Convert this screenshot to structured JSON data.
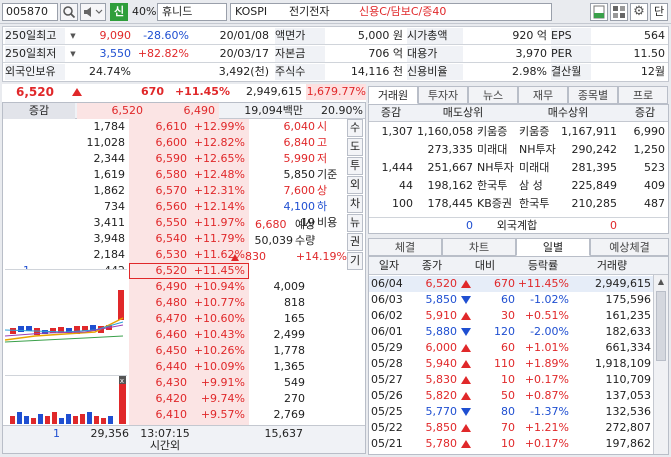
{
  "toolbar": {
    "code": "005870",
    "market_badge": "신",
    "margin": "40%",
    "name": "휴니드",
    "market": "KOSPI",
    "sector": "전기전자",
    "credit": "신용C/담보C/증40",
    "help_label": "단"
  },
  "info": {
    "rows": [
      {
        "label": "250일최고",
        "val": "9,090",
        "pct": "-28.60%",
        "date": "20/01/08",
        "l2": "액면가",
        "v2": "5,000 원",
        "l3": "시가총액",
        "v3": "920 억",
        "l4": "EPS",
        "v4": "564"
      },
      {
        "label": "250일최저",
        "val": "3,550",
        "pct": "+82.82%",
        "date": "20/03/17",
        "l2": "자본금",
        "v2": "706 억",
        "l3": "대용가",
        "v3": "3,970",
        "l4": "PER",
        "v4": "11.50"
      },
      {
        "label": "외국인보유",
        "val": "24.74%",
        "pct": "",
        "date": "3,492(천)",
        "l2": "주식수",
        "v2": "14,116 천",
        "l3": "신용비율",
        "v3": "2.98%",
        "l4": "결산월",
        "v4": "12월"
      }
    ]
  },
  "price_line": {
    "price": "6,520",
    "change": "670",
    "pct": "+11.45%",
    "volume": "2,949,615",
    "vol_pct": "1,679.77%"
  },
  "ob_header": {
    "label": "증감",
    "ask_top": "6,520",
    "bid_top": "6,490",
    "amount": "19,094백만",
    "rate": "20.90%"
  },
  "asks": [
    {
      "qty": "1,784",
      "price": "6,610",
      "pct": "+12.99%"
    },
    {
      "qty": "11,028",
      "price": "6,600",
      "pct": "+12.82%"
    },
    {
      "qty": "2,344",
      "price": "6,590",
      "pct": "+12.65%"
    },
    {
      "qty": "1,619",
      "price": "6,580",
      "pct": "+12.48%"
    },
    {
      "qty": "1,862",
      "price": "6,570",
      "pct": "+12.31%"
    },
    {
      "qty": "734",
      "price": "6,560",
      "pct": "+12.14%"
    },
    {
      "qty": "3,411",
      "price": "6,550",
      "pct": "+11.97%"
    },
    {
      "qty": "3,948",
      "price": "6,540",
      "pct": "+11.79%"
    },
    {
      "qty": "2,184",
      "price": "6,530",
      "pct": "+11.62%"
    },
    {
      "qty": "442",
      "price": "6,520",
      "pct": "+11.45%",
      "chg": "1"
    }
  ],
  "bids": [
    {
      "qty": "4,009",
      "price": "6,490",
      "pct": "+10.94%"
    },
    {
      "qty": "818",
      "price": "6,480",
      "pct": "+10.77%"
    },
    {
      "qty": "165",
      "price": "6,470",
      "pct": "+10.60%"
    },
    {
      "qty": "2,499",
      "price": "6,460",
      "pct": "+10.43%"
    },
    {
      "qty": "1,778",
      "price": "6,450",
      "pct": "+10.26%"
    },
    {
      "qty": "1,365",
      "price": "6,440",
      "pct": "+10.09%"
    },
    {
      "qty": "549",
      "price": "6,430",
      "pct": "+9.91%"
    },
    {
      "qty": "270",
      "price": "6,420",
      "pct": "+9.74%"
    },
    {
      "qty": "2,769",
      "price": "6,410",
      "pct": "+9.57%"
    },
    {
      "qty": "1,415",
      "price": "6,400",
      "pct": "+9.40%"
    }
  ],
  "ohlc": [
    {
      "price": "6,040",
      "label": "시",
      "color": "r"
    },
    {
      "price": "6,840",
      "label": "고",
      "color": "r"
    },
    {
      "price": "5,990",
      "label": "저",
      "color": "r"
    },
    {
      "price": "5,850",
      "label": "기준",
      "color": "k"
    },
    {
      "price": "7,600",
      "label": "상",
      "color": "r"
    },
    {
      "price": "4,100",
      "label": "하",
      "color": "b"
    },
    {
      "price": "19",
      "label": "비용",
      "color": "k"
    }
  ],
  "expect": {
    "price_label": "예상",
    "price": "6,680",
    "qty_label": "수량",
    "qty": "50,039",
    "chg": "830",
    "pct": "+14.19%"
  },
  "side_buttons": [
    "수",
    "도",
    "투",
    "외",
    "차",
    "뉴",
    "권",
    "기"
  ],
  "ob_footer": {
    "left": "1",
    "total_ask": "29,356",
    "time": "13:07:15",
    "total_bid": "15,637",
    "time_label": "시간외"
  },
  "broker_tabs": [
    "거래원",
    "투자자",
    "뉴스",
    "재무",
    "종목별",
    "프로"
  ],
  "broker_header": {
    "c1": "증감",
    "c2": "매도상위",
    "c3": "매수상위",
    "c4": "증감"
  },
  "brokers": [
    {
      "schg": "1,307",
      "sqty": "1,160,058",
      "sname": "키움증",
      "bname": "키움증",
      "bqty": "1,167,911",
      "bchg": "6,990"
    },
    {
      "schg": "",
      "sqty": "273,335",
      "sname": "미래대",
      "bname": "NH투자",
      "bqty": "290,242",
      "bchg": "1,250"
    },
    {
      "schg": "1,444",
      "sqty": "251,667",
      "sname": "NH투자",
      "bname": "미래대",
      "bqty": "281,395",
      "bchg": "523"
    },
    {
      "schg": "44",
      "sqty": "198,162",
      "sname": "한국투",
      "bname": "삼 성",
      "bqty": "225,849",
      "bchg": "409"
    },
    {
      "schg": "100",
      "sqty": "178,445",
      "sname": "KB증권",
      "bname": "한국투",
      "bqty": "210,285",
      "bchg": "487"
    }
  ],
  "foreign_row": {
    "left": "0",
    "label": "외국계합",
    "right": "0"
  },
  "daily_tabs": [
    "체결",
    "차트",
    "일별",
    "예상체결"
  ],
  "daily_header": [
    "일자",
    "종가",
    "대비",
    "등락률",
    "거래량"
  ],
  "daily": [
    {
      "date": "06/04",
      "close": "6,520",
      "dir": "up",
      "chg": "670",
      "pct": "+11.45%",
      "vol": "2,949,615"
    },
    {
      "date": "06/03",
      "close": "5,850",
      "dir": "dn",
      "chg": "60",
      "pct": "-1.02%",
      "vol": "175,596"
    },
    {
      "date": "06/02",
      "close": "5,910",
      "dir": "up",
      "chg": "30",
      "pct": "+0.51%",
      "vol": "161,235"
    },
    {
      "date": "06/01",
      "close": "5,880",
      "dir": "dn",
      "chg": "120",
      "pct": "-2.00%",
      "vol": "182,633"
    },
    {
      "date": "05/29",
      "close": "6,000",
      "dir": "up",
      "chg": "60",
      "pct": "+1.01%",
      "vol": "661,334"
    },
    {
      "date": "05/28",
      "close": "5,940",
      "dir": "up",
      "chg": "110",
      "pct": "+1.89%",
      "vol": "1,918,109"
    },
    {
      "date": "05/27",
      "close": "5,830",
      "dir": "up",
      "chg": "10",
      "pct": "+0.17%",
      "vol": "110,709"
    },
    {
      "date": "05/26",
      "close": "5,820",
      "dir": "up",
      "chg": "50",
      "pct": "+0.87%",
      "vol": "137,053"
    },
    {
      "date": "05/25",
      "close": "5,770",
      "dir": "dn",
      "chg": "80",
      "pct": "-1.37%",
      "vol": "132,536"
    },
    {
      "date": "05/22",
      "close": "5,850",
      "dir": "up",
      "chg": "70",
      "pct": "+1.21%",
      "vol": "272,807"
    },
    {
      "date": "05/21",
      "close": "5,780",
      "dir": "up",
      "chg": "10",
      "pct": "+0.17%",
      "vol": "197,862"
    }
  ],
  "colors": {
    "up": "#e0282a",
    "down": "#1f4fd1",
    "ask_bg": "#fbe4e4",
    "bid_bg": "#fbe4e4",
    "badge": "#2f9e3b"
  }
}
